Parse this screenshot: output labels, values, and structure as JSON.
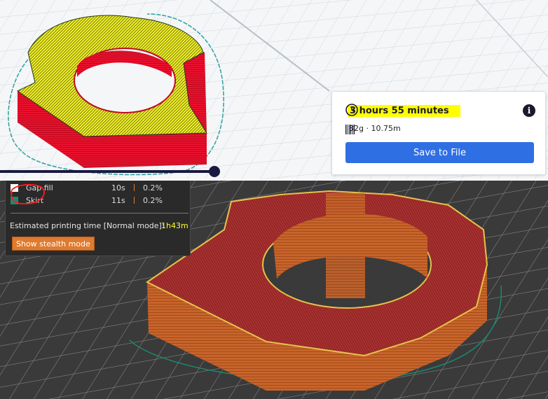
{
  "top_panel": {
    "print_time": "3 hours 55 minutes",
    "material_usage": "32g · 10.75m",
    "save_button": "Save to File",
    "info_symbol": "i",
    "icons": {
      "clock": "clock-icon",
      "spool": "spool-icon",
      "info": "info-icon"
    },
    "colors": {
      "highlight": "#ffff00",
      "button": "#2f6fe4",
      "model_wall": "#e8112d",
      "model_top": "#f2f22a"
    }
  },
  "bottom_panel": {
    "features": [
      {
        "label": "Gap fill",
        "time": "10s",
        "percent": "0.2%",
        "color": "#ffffff"
      },
      {
        "label": "Skirt",
        "time": "11s",
        "percent": "0.2%",
        "color": "#1a8a70"
      }
    ],
    "estimated_label": "Estimated printing time [Normal mode]:",
    "estimated_value": "1h43m",
    "stealth_button": "Show stealth mode",
    "colors": {
      "model": "#c8642a",
      "top": "#a83232",
      "button": "#e07a2e"
    }
  }
}
